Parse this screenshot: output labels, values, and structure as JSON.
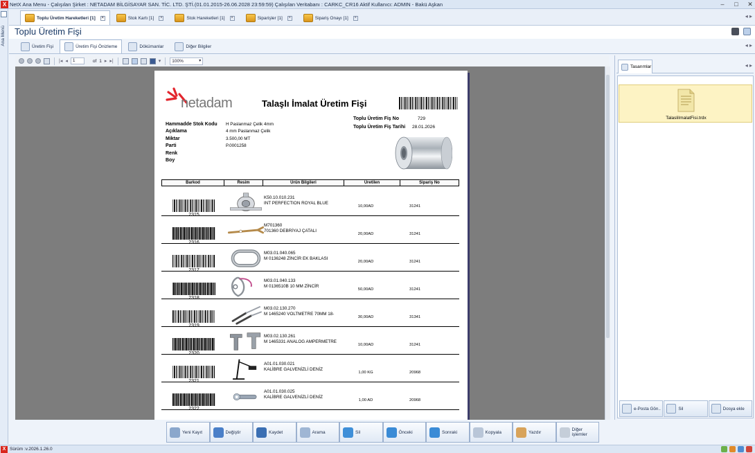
{
  "window": {
    "title": "NetX Ana Menu - Çalışılan Şirket : NETADAM BİLGİSAYAR SAN. TİC. LTD. ŞTİ.(01.01.2015-26.06.2028 23:59:59) Çalışılan Veritabanı : CARKC_CR16  Aktif Kullanıcı: ADMIN - Bakü Aşkan",
    "app_icon": "X"
  },
  "side_menu_label": "Ana Menü",
  "doc_tabs": [
    {
      "label": "Toplu Üretim Hareketleri [1]",
      "icon": "forklift-icon",
      "active": true
    },
    {
      "label": "Stok Kartı [1]",
      "icon": "box-icon",
      "active": false
    },
    {
      "label": "Stok Hareketleri [1]",
      "icon": "boxes-icon",
      "active": false
    },
    {
      "label": "Siparişler [1]",
      "icon": "order-icon",
      "active": false
    },
    {
      "label": "Sipariş Onayı [1]",
      "icon": "order-approve-icon",
      "active": false
    }
  ],
  "form_title": "Toplu Üretim Fişi",
  "sub_tabs": [
    {
      "label": "Üretim Fişi",
      "active": false
    },
    {
      "label": "Üretim Fişi Önizleme",
      "active": true
    },
    {
      "label": "Dökümanlar",
      "active": false
    },
    {
      "label": "Diğer Bilgiler",
      "active": false
    }
  ],
  "viewer_toolbar": {
    "page_current": "1",
    "page_of": "of",
    "page_total": "1",
    "zoom": "100%"
  },
  "report": {
    "logo_text": "netadam",
    "title": "Talaşlı İmalat Üretim Fişi",
    "fis_no_label": "Toplu Üretim Fiş No",
    "fis_no": "729",
    "fis_tarih_label": "Toplu Üretim Fiş Tarihi",
    "fis_tarih": "28.01.2026",
    "fields": [
      {
        "label": "Hammadde Stok Kodu",
        "value": "H Paslanmaz Çelik 4mm"
      },
      {
        "label": "Açıklama",
        "value": "4 mm Paslanmaz Çelik"
      },
      {
        "label": "Miktar",
        "value": "3.500,00   MT"
      },
      {
        "label": "Parti",
        "value": "P.0001258"
      },
      {
        "label": "Renk",
        "value": ""
      },
      {
        "label": "Boy",
        "value": ""
      }
    ],
    "columns": [
      "Barkod",
      "Resim",
      "Ürün Bilgileri",
      "Üretilen",
      "Sipariş No"
    ],
    "rows": [
      {
        "barcode": "2315",
        "code": "K50.10.010.231",
        "name": "INT PERFECTION ROYAL BLUE",
        "qty": "10,00AD",
        "order": "31241",
        "pic": "winch"
      },
      {
        "barcode": "2316",
        "code": "M701360",
        "name": "701360 DEBRİYAJ ÇATALI",
        "qty": "20,00AD",
        "order": "31241",
        "pic": "fork"
      },
      {
        "barcode": "2317",
        "code": "M03.01.040.065",
        "name": "M 0136248 ZİNCİR EK BAKLASI",
        "qty": "20,00AD",
        "order": "31241",
        "pic": "link"
      },
      {
        "barcode": "2318",
        "code": "M03.01.040.133",
        "name": "M 0136510B 10 MM ZİNCİR",
        "qty": "50,00AD",
        "order": "31241",
        "pic": "chain"
      },
      {
        "barcode": "2319",
        "code": "M03.02.130.270",
        "name": "M 1465240 VOLTMETRE 70MM 18-",
        "qty": "30,00AD",
        "order": "31341",
        "pic": "rods"
      },
      {
        "barcode": "2320",
        "code": "M03.02.130.261",
        "name": "M 1465331 ANALOG AMPERMETRE",
        "qty": "10,00AD",
        "order": "31241",
        "pic": "bolts"
      },
      {
        "barcode": "2321",
        "code": "A01.01.030.021",
        "name": "KALİBRE GALVENİZLİ DENİZ",
        "qty": "1,00  KG",
        "order": "20968",
        "pic": "stand"
      },
      {
        "barcode": "2322",
        "code": "A01.01.030.025",
        "name": "KALİBRE GALVENİZLİ DENİZ",
        "qty": "1,00  AD",
        "order": "20968",
        "pic": "pin"
      }
    ]
  },
  "right_panel": {
    "tab_label": "Tasarımlar",
    "file_name": "TalasliImalatFisi.trdx",
    "buttons": [
      "e-Posta Gön..",
      "Sil",
      "Dosya ekle"
    ]
  },
  "bottom_buttons": [
    {
      "label": "Yeni Kayıt",
      "color": "#8aa7cc"
    },
    {
      "label": "Değiştir",
      "color": "#4a7fc8"
    },
    {
      "label": "Kaydet",
      "color": "#3b6fb3"
    },
    {
      "label": "Arama",
      "color": "#9fb6d4"
    },
    {
      "label": "Sil",
      "color": "#3f8fd8"
    },
    {
      "label": "Önceki",
      "color": "#3a8bd6"
    },
    {
      "label": "Sonraki",
      "color": "#3a8bd6"
    },
    {
      "label": "Kopyala",
      "color": "#b9c6d8"
    },
    {
      "label": "Yazdır",
      "color": "#d8a35a"
    },
    {
      "label": "Diğer işlemler",
      "color": "#c5ced9"
    }
  ],
  "status": {
    "version": "Sürüm :v.2026.1.26.0"
  }
}
